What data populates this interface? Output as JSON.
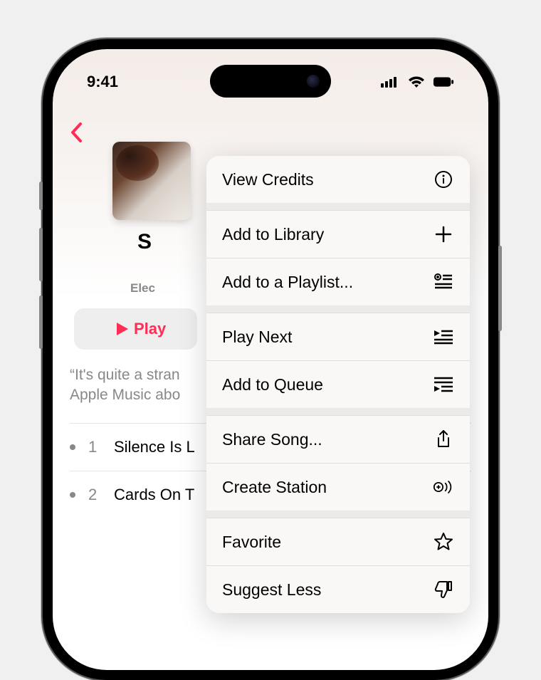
{
  "status_bar": {
    "time": "9:41"
  },
  "album": {
    "title_visible": "S",
    "genre_visible": "Elec",
    "artwork_alt": "album-artwork"
  },
  "controls": {
    "play_label": "Play"
  },
  "description": {
    "line1": "“It's quite a stran",
    "line2": "Apple Music abo"
  },
  "tracks": [
    {
      "num": "1",
      "title_visible": "Silence Is L"
    },
    {
      "num": "2",
      "title_visible": "Cards On T"
    }
  ],
  "menu": {
    "view_credits": "View Credits",
    "add_library": "Add to Library",
    "add_playlist": "Add to a Playlist...",
    "play_next": "Play Next",
    "add_queue": "Add to Queue",
    "share_song": "Share Song...",
    "create_station": "Create Station",
    "favorite": "Favorite",
    "suggest_less": "Suggest Less"
  }
}
